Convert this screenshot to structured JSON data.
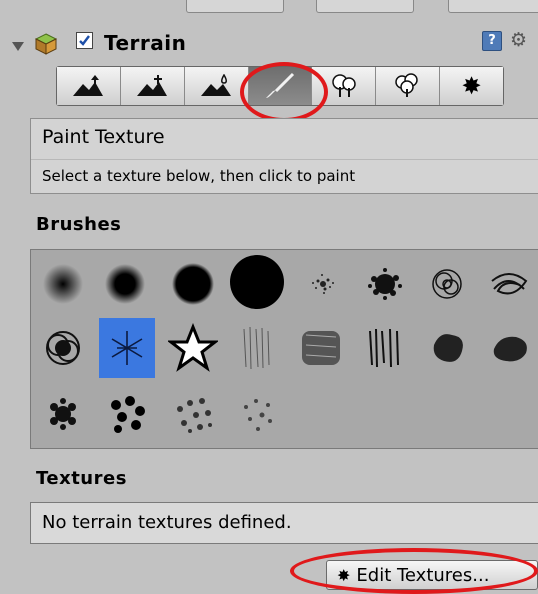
{
  "component": {
    "title": "Terrain",
    "enabled": true,
    "help_icon": "?"
  },
  "toolbar": {
    "tools": [
      {
        "icon": "raise-lower-terrain-icon"
      },
      {
        "icon": "set-height-icon"
      },
      {
        "icon": "smooth-height-icon"
      },
      {
        "icon": "paint-texture-icon",
        "selected": true
      },
      {
        "icon": "place-trees-icon"
      },
      {
        "icon": "paint-details-icon"
      },
      {
        "icon": "terrain-settings-icon"
      }
    ]
  },
  "description": {
    "title": "Paint Texture",
    "subtitle": "Select a texture below, then click to paint"
  },
  "brushes": {
    "label": "Brushes",
    "selected_index": 9,
    "count": 20
  },
  "textures": {
    "label": "Textures",
    "empty_message": "No terrain textures defined.",
    "edit_button": "Edit Textures..."
  },
  "colors": {
    "highlight": "#e0191b",
    "selection": "#3b78e0"
  }
}
